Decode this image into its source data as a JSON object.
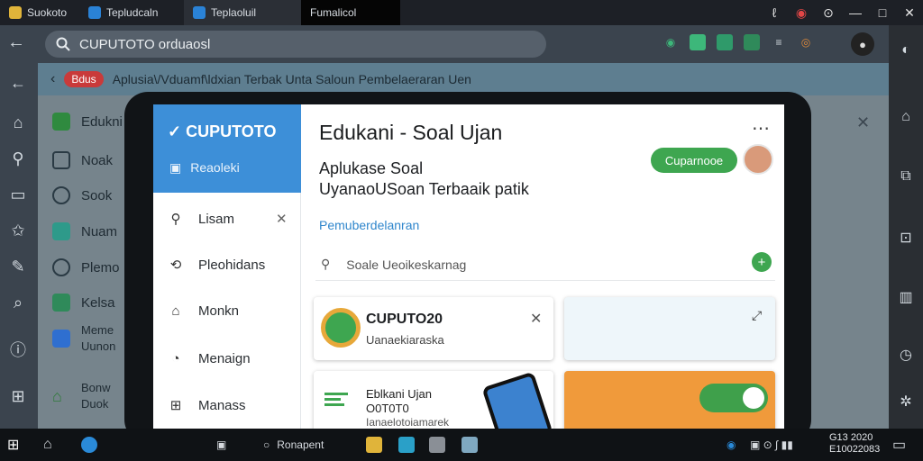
{
  "window": {
    "tabs": [
      {
        "label": "Suokoto",
        "color": "#d9442a"
      },
      {
        "label": "Tepludcaln",
        "color": "#2a82d6"
      },
      {
        "label": "Teplaoluil",
        "color": "#2a82d6"
      },
      {
        "label": "Fumalicol",
        "color": "#000000"
      }
    ],
    "controls": [
      "ℓ",
      "◉",
      "⊙",
      "—",
      "□",
      "✕"
    ]
  },
  "addressbar": {
    "query": "CUPUTOTO orduaosl",
    "back": "←"
  },
  "page": {
    "badge": "Bdus",
    "breadcrumb": "Aplusia\\/Vduamf\\ldxian Terbak  Unta   Saloun Pembelaeraran   Uen",
    "background_items": [
      {
        "label": "Edukni",
        "color": "#2f8a3f"
      },
      {
        "label": "Noak",
        "color": "#4a5660"
      },
      {
        "label": "Sook",
        "color": "#4a5660"
      },
      {
        "label": "Nuam",
        "color": "#2e9a8a"
      },
      {
        "label": "Plemo",
        "color": "#4a5660"
      },
      {
        "label": "Kelsa",
        "color": "#2f8a5a"
      },
      {
        "label": "Meme\nUunon",
        "color": "#2f6fd0"
      },
      {
        "label": "Bonw\nDuok",
        "color": "#2f7a3a"
      }
    ]
  },
  "drawer": {
    "brand": "CUPUTOTO",
    "section": "Reaoleki",
    "items": [
      {
        "label": "Lisam",
        "icon": "search-icon"
      },
      {
        "label": "Pleohidans",
        "icon": "share-icon"
      },
      {
        "label": "Monkn",
        "icon": "home-icon"
      },
      {
        "label": "Menaign",
        "icon": "chat-icon"
      },
      {
        "label": "Manass",
        "icon": "grid-icon"
      }
    ]
  },
  "main": {
    "title": "Edukani - Soal Ujan",
    "description": "Aplukase Soal\nUyanaoUSoan Terbaaik patik",
    "button": "Cuparnooe",
    "link": "Pemuberdelanran",
    "search_placeholder": "Soale Ueoikeskarnag",
    "card1": {
      "title": "CUPUTO20",
      "subtitle": "Uanaekiaraska"
    },
    "card3": {
      "line1": "Eblkani Ujan",
      "line2": "O0T0T0",
      "line3": "Ianaelotoiamarek"
    }
  },
  "taskbar": {
    "items": [
      "Ronapent"
    ],
    "clock_time": "G13  2020",
    "clock_date": "E10022083"
  }
}
